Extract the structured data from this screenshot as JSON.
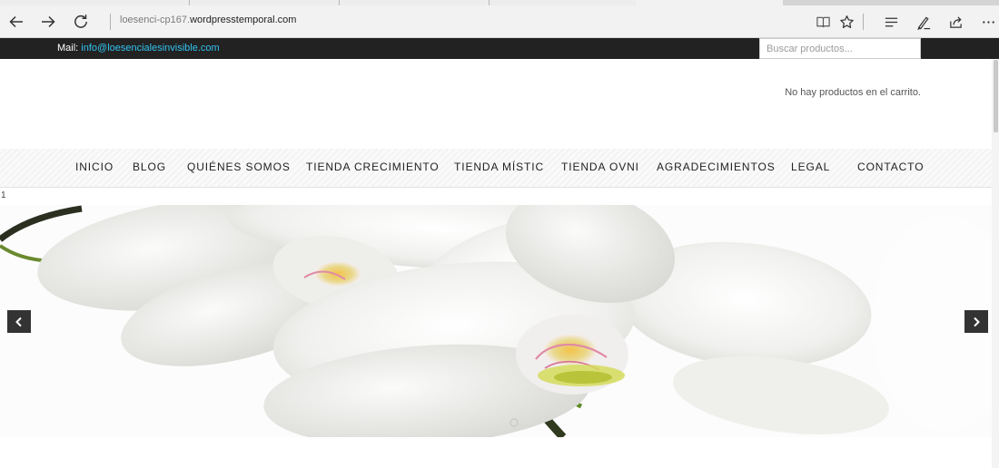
{
  "browser": {
    "address_prefix": "loesenci-cp167.",
    "address_domain": "wordpresstemporal.com",
    "icons": [
      "back-icon",
      "forward-icon",
      "refresh-icon",
      "reading-view-icon",
      "favorite-star-icon",
      "hub-icon",
      "web-note-icon",
      "share-icon",
      "more-icon"
    ]
  },
  "topbar": {
    "mail_label": "Mail:",
    "mail_address": "info@loesencialesinvisible.com",
    "search_placeholder": "Buscar productos..."
  },
  "header": {
    "cart_text": "No hay productos en el carrito."
  },
  "menu": {
    "items": [
      "INICIO",
      "BLOG",
      "QUIÉNES SOMOS",
      "TIENDA CRECIMIENTO",
      "TIENDA MÍSTIC",
      "TIENDA OVNI",
      "AGRADECIMIENTOS",
      "LEGAL",
      "CONTACTO"
    ]
  },
  "slider": {
    "index_label": "1",
    "image_subject": "white orchid flowers",
    "icons": [
      "chevron-left-icon",
      "chevron-right-icon"
    ]
  },
  "colors": {
    "topbar_bg": "#222222",
    "link": "#33c3f0",
    "arrow_bg": "#333333"
  }
}
